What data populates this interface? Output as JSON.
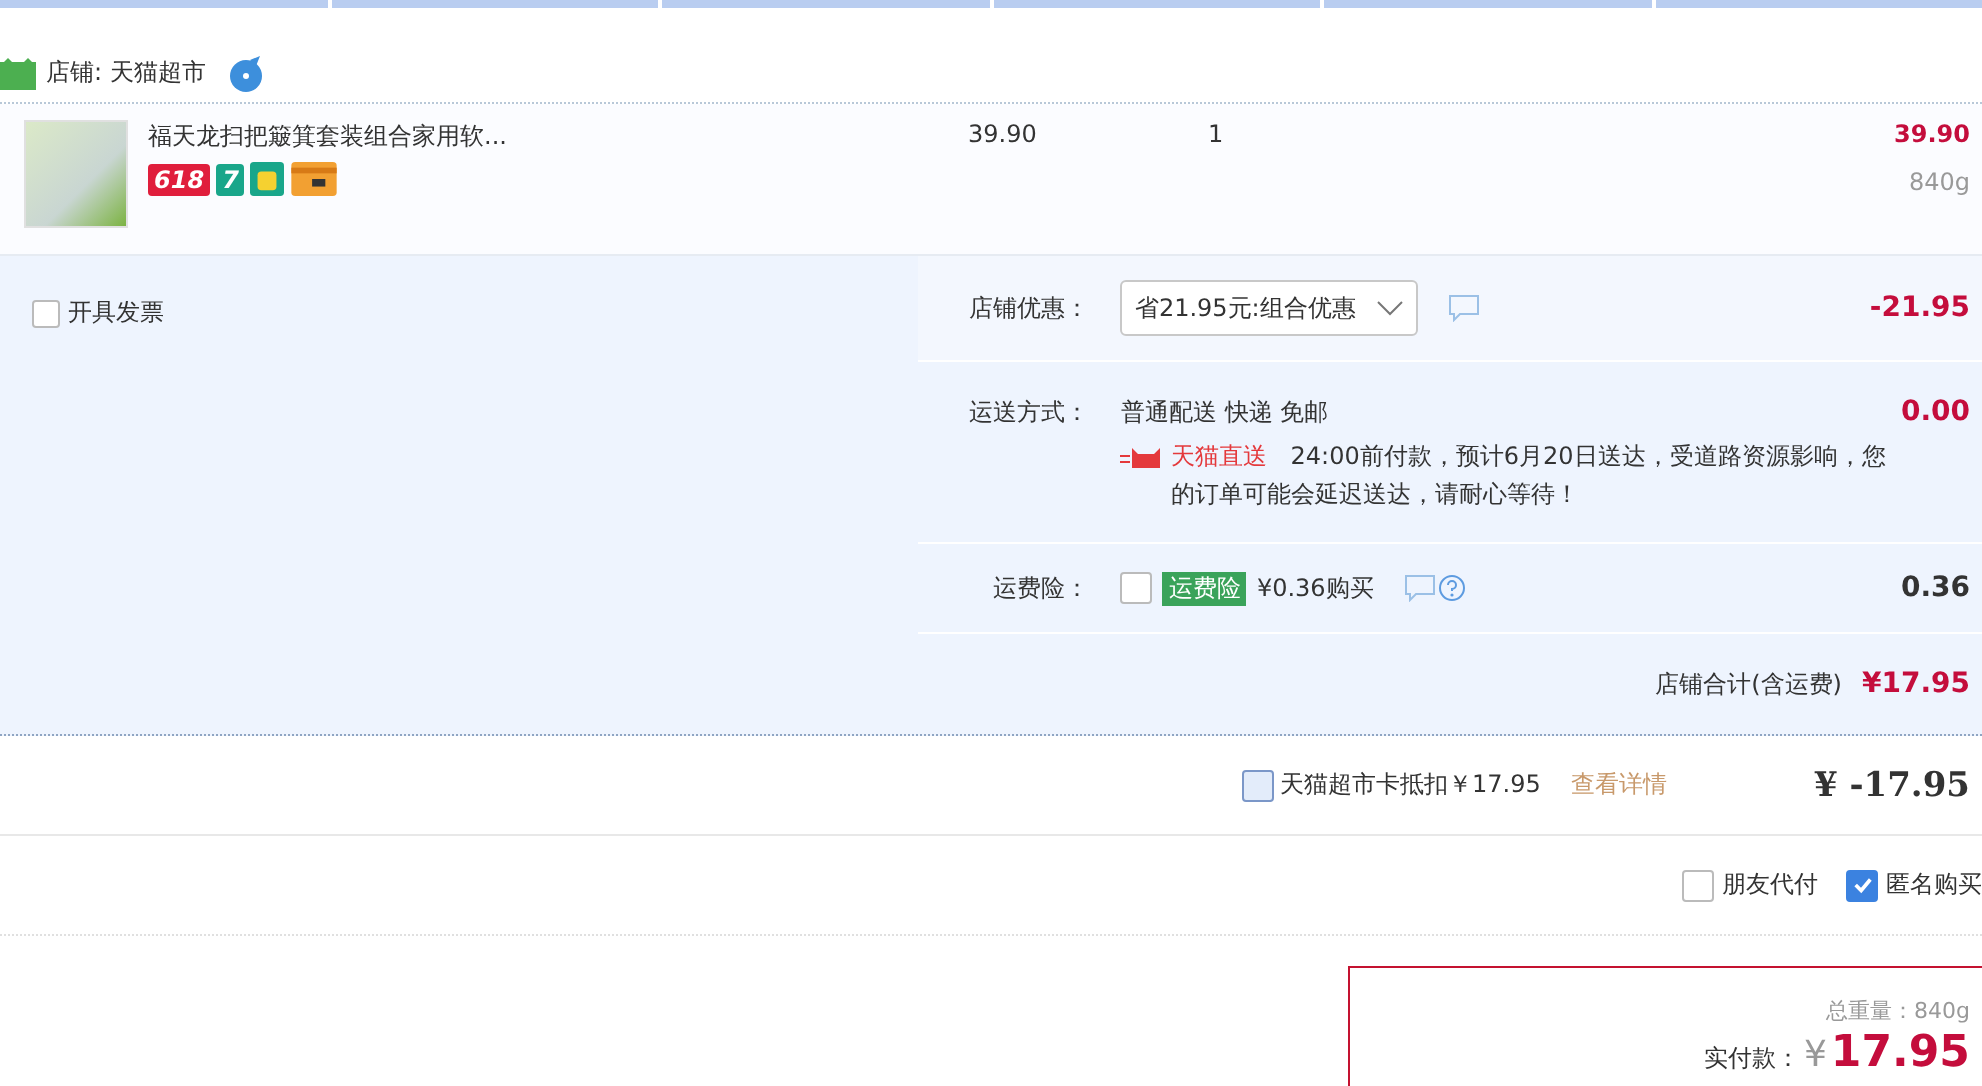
{
  "store": {
    "name": "店铺: 天猫超市"
  },
  "item": {
    "title": "福天龙扫把簸箕套装组合家用软...",
    "unit_price": "39.90",
    "quantity": "1",
    "subtotal": "39.90",
    "weight": "840g",
    "badges": [
      {
        "kind": "text",
        "text": "618"
      },
      {
        "kind": "text",
        "text": "7"
      },
      {
        "kind": "icon"
      },
      {
        "kind": "card"
      }
    ]
  },
  "invoice": {
    "label": "开具发票",
    "checked": false
  },
  "discount": {
    "label": "店铺优惠：",
    "value": "省21.95元:组合优惠",
    "amount": "-21.95"
  },
  "shipping": {
    "label": "运送方式：",
    "method": "普通配送 快递 免邮",
    "amount": "0.00",
    "brand": "天猫直送",
    "note": "24:00前付款，预计6月20日送达，受道路资源影响，您的订单可能会延迟送达，请耐心等待！"
  },
  "insurance": {
    "label": "运费险：",
    "checked": false,
    "tag": "运费险",
    "price": "¥0.36购买",
    "amount": "0.36"
  },
  "store_total": {
    "label": "店铺合计(含运费)",
    "amount": "¥17.95"
  },
  "card": {
    "label": "天猫超市卡抵扣￥17.95",
    "checked": false,
    "link": "查看详情",
    "amount": "¥ -17.95"
  },
  "options": [
    {
      "label": "朋友代付",
      "checked": false
    },
    {
      "label": "匿名购买",
      "checked": true
    }
  ],
  "summary": {
    "weight": "总重量：840g",
    "pay_label": "实付款：",
    "currency": "¥",
    "amount": "17.95"
  }
}
